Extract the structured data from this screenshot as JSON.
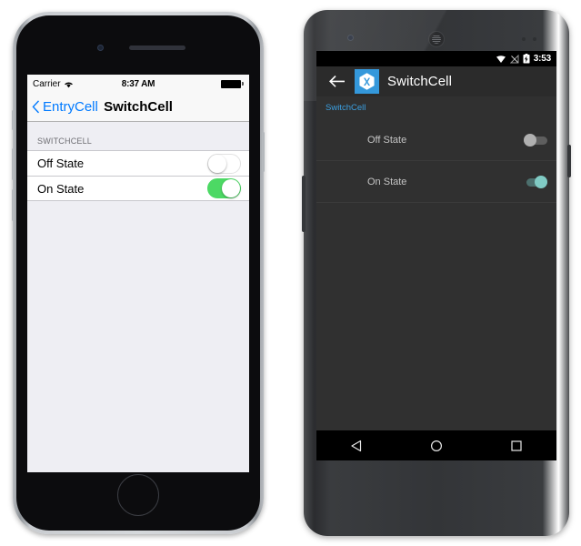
{
  "ios": {
    "status_bar": {
      "carrier": "Carrier",
      "wifi_icon": "wifi-icon",
      "time": "8:37 AM",
      "battery_icon": "battery-full-icon"
    },
    "nav_bar": {
      "back_icon": "chevron-left-icon",
      "back_label": "EntryCell",
      "title": "SwitchCell"
    },
    "table": {
      "section_header": "SWITCHCELL",
      "rows": [
        {
          "label": "Off State",
          "state": "off"
        },
        {
          "label": "On State",
          "state": "on"
        }
      ]
    },
    "colors": {
      "tint": "#007aff",
      "switch_on": "#4cd964",
      "background": "#eeeef3"
    }
  },
  "android": {
    "status_bar": {
      "wifi_icon": "wifi-icon",
      "signal_icon": "signal-off-icon",
      "battery_icon": "battery-charging-icon",
      "clock": "3:53"
    },
    "toolbar": {
      "back_icon": "arrow-left-icon",
      "app_logo_icon": "xamarin-logo-icon",
      "title": "SwitchCell"
    },
    "list": {
      "section_header": "SwitchCell",
      "rows": [
        {
          "label": "Off State",
          "state": "off"
        },
        {
          "label": "On State",
          "state": "on"
        }
      ]
    },
    "nav_bar": {
      "back_icon": "triangle-back-icon",
      "home_icon": "circle-home-icon",
      "recents_icon": "square-recents-icon"
    },
    "colors": {
      "accent": "#3b9fe0",
      "logo_blue": "#3498db",
      "switch_on_thumb": "#80cbc4",
      "background": "#303030"
    }
  }
}
